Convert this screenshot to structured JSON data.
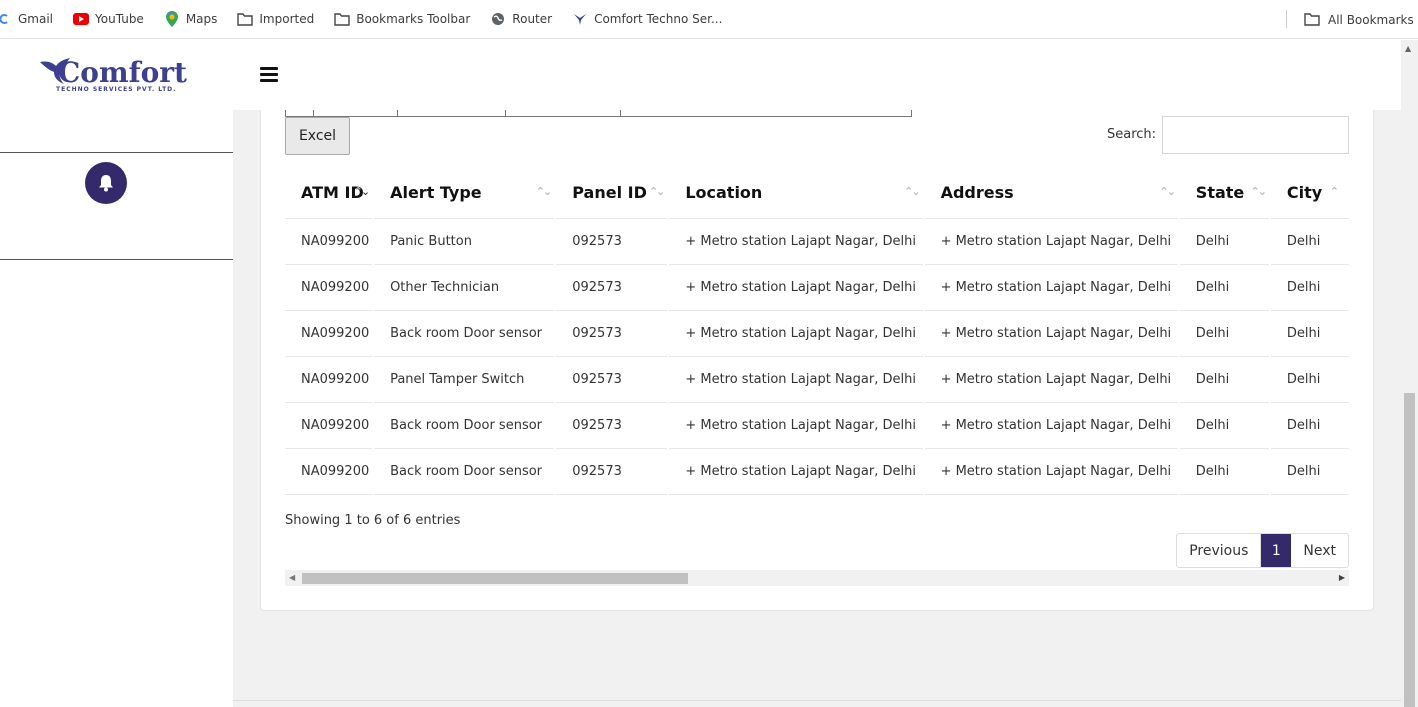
{
  "bookmarks": {
    "items": [
      {
        "label": "Gmail",
        "icon": "gmail-icon"
      },
      {
        "label": "YouTube",
        "icon": "youtube-icon"
      },
      {
        "label": "Maps",
        "icon": "maps-icon"
      },
      {
        "label": "Imported",
        "icon": "folder-icon"
      },
      {
        "label": "Bookmarks Toolbar",
        "icon": "folder-icon"
      },
      {
        "label": "Router",
        "icon": "globe-icon"
      },
      {
        "label": "Comfort Techno Ser...",
        "icon": "comfort-favicon-icon"
      }
    ],
    "all_bookmarks": "All Bookmarks"
  },
  "logo": {
    "word": "Comfort",
    "subtitle": "TECHNO SERVICES PVT. LTD."
  },
  "colors": {
    "brand": "#33296b",
    "logo": "#3d3f8f"
  },
  "toolbar": {
    "excel_label": "Excel",
    "search_label": "Search:",
    "search_value": ""
  },
  "table": {
    "columns": [
      "ATM ID",
      "Alert Type",
      "Panel ID",
      "Location",
      "Address",
      "State",
      "City"
    ],
    "rows": [
      [
        "NA099200",
        "Panic Button",
        "092573",
        "+ Metro station Lajapt Nagar, Delhi",
        "+ Metro station Lajapt Nagar, Delhi",
        "Delhi",
        "Delhi"
      ],
      [
        "NA099200",
        "Other Technician",
        "092573",
        "+ Metro station Lajapt Nagar, Delhi",
        "+ Metro station Lajapt Nagar, Delhi",
        "Delhi",
        "Delhi"
      ],
      [
        "NA099200",
        "Back room Door sensor",
        "092573",
        "+ Metro station Lajapt Nagar, Delhi",
        "+ Metro station Lajapt Nagar, Delhi",
        "Delhi",
        "Delhi"
      ],
      [
        "NA099200",
        "Panel Tamper Switch",
        "092573",
        "+ Metro station Lajapt Nagar, Delhi",
        "+ Metro station Lajapt Nagar, Delhi",
        "Delhi",
        "Delhi"
      ],
      [
        "NA099200",
        "Back room Door sensor",
        "092573",
        "+ Metro station Lajapt Nagar, Delhi",
        "+ Metro station Lajapt Nagar, Delhi",
        "Delhi",
        "Delhi"
      ],
      [
        "NA099200",
        "Back room Door sensor",
        "092573",
        "+ Metro station Lajapt Nagar, Delhi",
        "+ Metro station Lajapt Nagar, Delhi",
        "Delhi",
        "Delhi"
      ]
    ]
  },
  "footer": {
    "showing": "Showing 1 to 6 of 6 entries",
    "prev_label": "Previous",
    "page_label": "1",
    "next_label": "Next"
  }
}
